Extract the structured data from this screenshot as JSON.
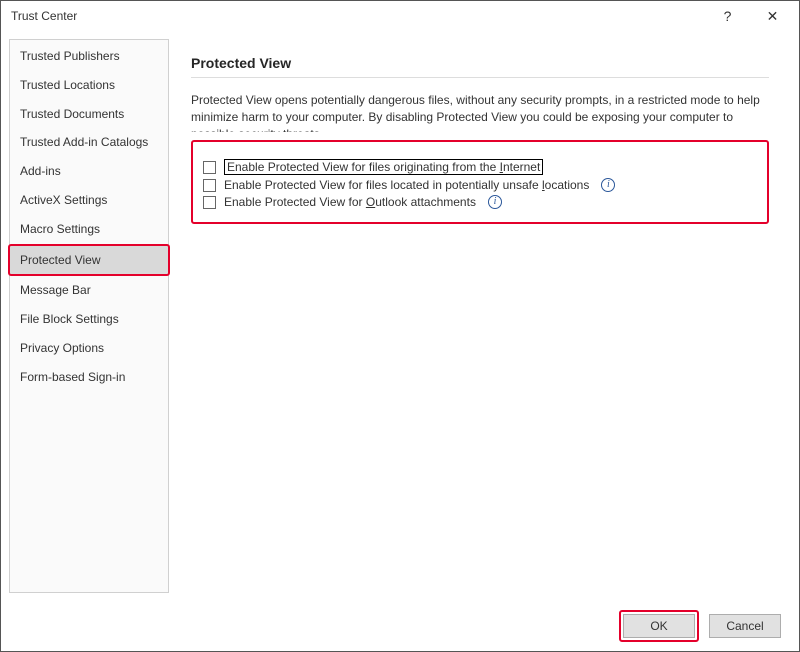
{
  "window": {
    "title": "Trust Center"
  },
  "titlebar": {
    "help_glyph": "?",
    "close_glyph": "✕"
  },
  "sidebar": {
    "items": [
      {
        "id": "trusted-publishers",
        "label": "Trusted Publishers",
        "selected": false
      },
      {
        "id": "trusted-locations",
        "label": "Trusted Locations",
        "selected": false
      },
      {
        "id": "trusted-documents",
        "label": "Trusted Documents",
        "selected": false
      },
      {
        "id": "trusted-addins",
        "label": "Trusted Add-in Catalogs",
        "selected": false
      },
      {
        "id": "add-ins",
        "label": "Add-ins",
        "selected": false
      },
      {
        "id": "activex",
        "label": "ActiveX Settings",
        "selected": false
      },
      {
        "id": "macro",
        "label": "Macro Settings",
        "selected": false
      },
      {
        "id": "protected-view",
        "label": "Protected View",
        "selected": true
      },
      {
        "id": "message-bar",
        "label": "Message Bar",
        "selected": false
      },
      {
        "id": "file-block",
        "label": "File Block Settings",
        "selected": false
      },
      {
        "id": "privacy",
        "label": "Privacy Options",
        "selected": false
      },
      {
        "id": "form-signin",
        "label": "Form-based Sign-in",
        "selected": false
      }
    ]
  },
  "main": {
    "heading": "Protected View",
    "description": "Protected View opens potentially dangerous files, without any security prompts, in a restricted mode to help minimize harm to your computer. By disabling Protected View you could be exposing your computer to possible security threats.",
    "options": [
      {
        "id": "pv-internet",
        "checked": false,
        "lead": "Enable Protected View for files originating from the ",
        "u": "I",
        "tail": "nternet",
        "has_info": false,
        "focused": true
      },
      {
        "id": "pv-unsafe-loc",
        "checked": false,
        "lead": "Enable Protected View for files located in potentially unsafe ",
        "u": "l",
        "tail": "ocations",
        "has_info": true,
        "focused": false
      },
      {
        "id": "pv-outlook",
        "checked": false,
        "lead": "Enable Protected View for ",
        "u": "O",
        "tail": "utlook attachments",
        "has_info": true,
        "focused": false
      }
    ]
  },
  "footer": {
    "ok_label": "OK",
    "cancel_label": "Cancel"
  },
  "annotation_color": "#e4002b"
}
